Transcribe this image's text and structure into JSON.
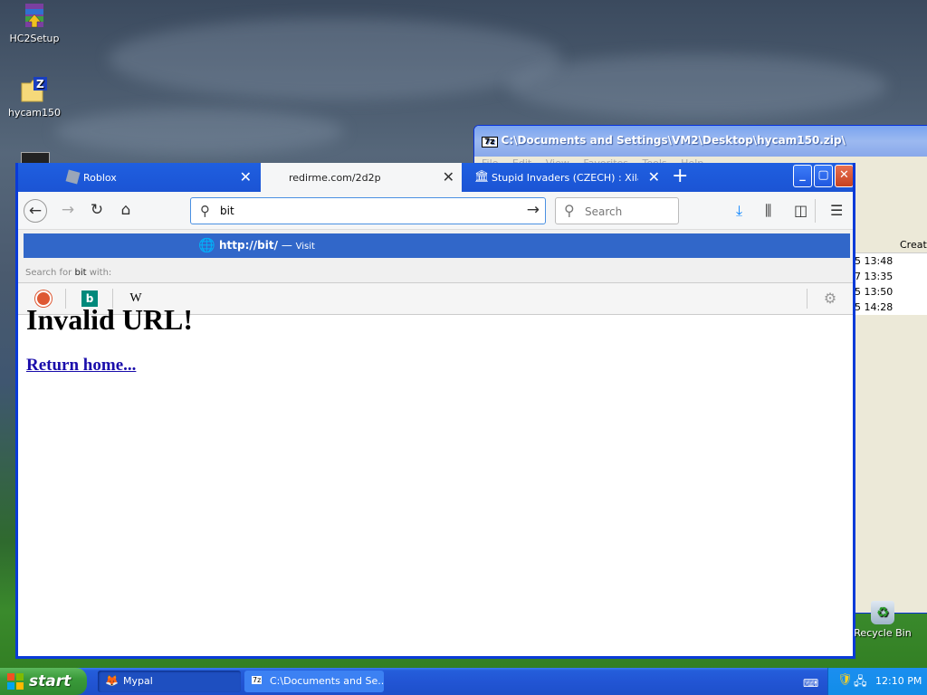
{
  "desktop": {
    "icons": [
      {
        "label": "HC2Setup"
      },
      {
        "label": "hycam150"
      }
    ],
    "recycle_bin": "Recycle Bin"
  },
  "zip_window": {
    "title": "C:\\Documents and Settings\\VM2\\Desktop\\hycam150.zip\\",
    "menu": [
      "File",
      "Edit",
      "View",
      "Favorites",
      "Tools",
      "Help"
    ],
    "column_header": "Creat",
    "rows": [
      "5 13:48",
      "7 13:35",
      "5 13:50",
      "5 14:28"
    ]
  },
  "browser": {
    "tabs": [
      {
        "label": "Roblox",
        "active": false
      },
      {
        "label": "redirme.com/2d2p",
        "active": true
      },
      {
        "label": "Stupid Invaders (CZECH) : Xilam :",
        "active": false
      }
    ],
    "url_value": "bit",
    "search_placeholder": "Search",
    "suggestion": {
      "url": "http://bit/",
      "dash": "—",
      "action": "Visit"
    },
    "search_with": {
      "prefix": "Search for ",
      "term": "bit",
      "suffix": " with:"
    },
    "engines": [
      {
        "name": "duckduckgo-icon"
      },
      {
        "name": "bing-icon",
        "glyph": "b"
      },
      {
        "name": "wikipedia-icon",
        "glyph": "W"
      }
    ],
    "page": {
      "heading": "Invalid URL!",
      "link": "Return home..."
    }
  },
  "taskbar": {
    "start": "start",
    "buttons": [
      {
        "label": "Mypal"
      },
      {
        "label": "C:\\Documents and Se..."
      }
    ],
    "clock": "12:10 PM"
  },
  "colors": {
    "titlebar_blue": "#0a3bd8",
    "suggestion_blue": "#3167c9",
    "link_blue": "#1a0dab",
    "start_green": "#3a9a3a"
  }
}
